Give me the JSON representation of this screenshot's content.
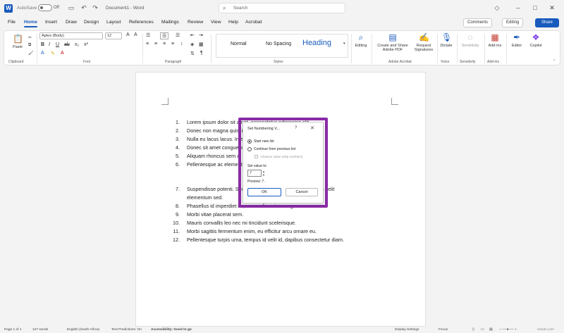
{
  "titlebar": {
    "autosave": "AutoSave",
    "toggle": "Off",
    "document_title": "Document1 - Word",
    "search_placeholder": "Search"
  },
  "menu": {
    "items": [
      "File",
      "Home",
      "Insert",
      "Draw",
      "Design",
      "Layout",
      "References",
      "Mailings",
      "Review",
      "View",
      "Help",
      "Acrobat"
    ],
    "active": "Home",
    "comments": "Comments",
    "editing": "Editing",
    "share": "Share"
  },
  "ribbon": {
    "paste": "Paste",
    "font_name": "Aptos (Body)",
    "font_size": "12",
    "styles": [
      "Normal",
      "No Spacing",
      "Heading"
    ],
    "editing": "Editing",
    "create_share_pdf": "Create and Share Adobe PDF",
    "request_signatures": "Request Signatures",
    "dictate": "Dictate",
    "sensitivity": "Sensitivity",
    "addins": "Add-ins",
    "editor": "Editor",
    "copilot": "Copilot",
    "groups": {
      "clipboard": "Clipboard",
      "font": "Font",
      "paragraph": "Paragraph",
      "styles": "Styles",
      "adobe_acrobat": "Adobe Acrobat",
      "voice": "Voice",
      "sensitivity": "Sensitivity",
      "addins": "Add-ins"
    }
  },
  "document": {
    "list_first": [
      {
        "num": "1.",
        "text": "Lorem ipsum dolor sit amet, consectetur adipiscing elit."
      },
      {
        "num": "2.",
        "text": "Donec non magna quis ligula tempor ultrices vitae neque."
      },
      {
        "num": "3.",
        "text": "Nulla eu lacus lacus. Integer vel gravida risus."
      },
      {
        "num": "4.",
        "text": "Donec sit amet congue lorem, a tincidunt nibh."
      },
      {
        "num": "5.",
        "text": "Aliquam rhoncus sem at erat bibendum, quis feugiat in."
      },
      {
        "num": "6.",
        "text": "Pellentesque ac elementum erat, et tristique arcu."
      }
    ],
    "list_second": [
      {
        "num": "7.",
        "text": "Suspendisse potenti. Sed condimentum ligula, nec bibendum velit"
      },
      {
        "num": "",
        "text": "elementum sed."
      },
      {
        "num": "8.",
        "text": "Phasellus id imperdiet mi, ac condimentum augue."
      },
      {
        "num": "9.",
        "text": "Morbi vitae placerat sem."
      },
      {
        "num": "10.",
        "text": "Mauris convallis leo nec mi tincidunt scelerisque."
      },
      {
        "num": "11.",
        "text": "Morbi sagittis fermentum enim, eu efficitur arcu ornare eu."
      },
      {
        "num": "12.",
        "text": "Pellentesque turpis urna, tempus id velit id, dapibus consectetur diam."
      }
    ]
  },
  "dialog": {
    "title": "Set Numbering V...",
    "help": "?",
    "close": "✕",
    "option_new": "Start new list",
    "option_continue": "Continue from previous list",
    "option_advance": "Advance value (skip numbers)",
    "set_value_label": "Set value to:",
    "value": "7",
    "preview": "Preview: 7.",
    "ok": "OK",
    "cancel": "Cancel"
  },
  "status": {
    "page": "Page 1 of 1",
    "words": "127 words",
    "language": "English (South Africa)",
    "predictions": "Text Predictions: On",
    "accessibility": "Accessibility: Good to go",
    "display": "Display Settings",
    "focus": "Focus",
    "watermark": "wsxdn.com"
  }
}
